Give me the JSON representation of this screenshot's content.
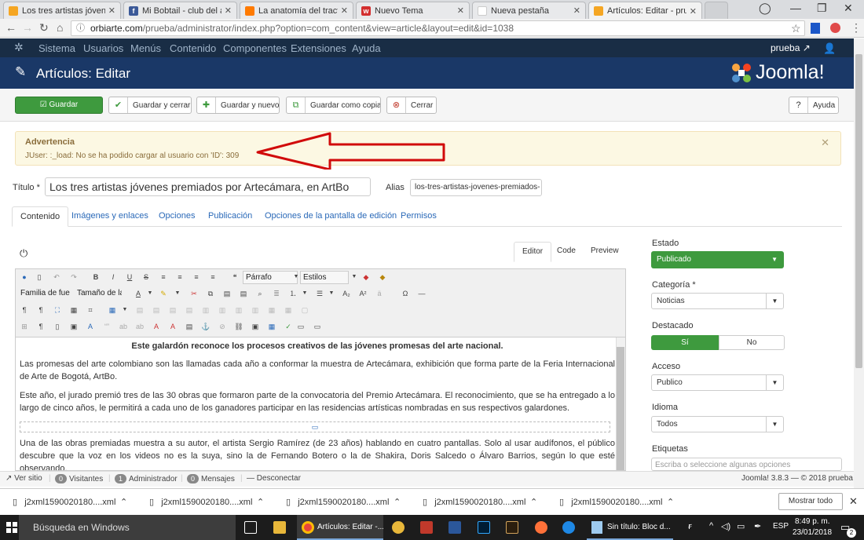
{
  "browser": {
    "tabs": [
      {
        "title": "Los tres artistas jóvenes p",
        "fav": "#f5a623",
        "active": false
      },
      {
        "title": "Mi Bobtail - club del ant",
        "fav": "#3b5998",
        "active": false
      },
      {
        "title": "La anatomía del tracto d",
        "fav": "#ff7a00",
        "active": false
      },
      {
        "title": "Nuevo Tema",
        "fav": "#d32f2f",
        "active": false
      },
      {
        "title": "Nueva pestaña",
        "fav": "#ffffff",
        "active": false
      },
      {
        "title": "Artículos: Editar - prueba",
        "fav": "#f5a623",
        "active": true
      }
    ],
    "url_domain": "orbiarte.com",
    "url_path": "/prueba/administrator/index.php?option=com_content&view=article&layout=edit&id=1038"
  },
  "adminbar": {
    "items": [
      "Sistema",
      "Usuarios",
      "Menús",
      "Contenido",
      "Componentes",
      "Extensiones",
      "Ayuda"
    ],
    "user": "prueba"
  },
  "titlebar": {
    "title": "Artículos: Editar",
    "brand": "Joomla!"
  },
  "toolbar": {
    "save": "Guardar",
    "save_close": "Guardar y cerrar",
    "save_new": "Guardar y nuevo",
    "save_copy": "Guardar como copia",
    "close": "Cerrar",
    "help": "Ayuda"
  },
  "warning": {
    "heading": "Advertencia",
    "message": "JUser: :_load: No se ha podido cargar al usuario con 'ID': 309"
  },
  "form": {
    "title_label": "Título *",
    "title_value": "Los tres artistas jóvenes premiados por Artecámara, en ArtBo",
    "alias_label": "Alias",
    "alias_value": "los-tres-artistas-jovenes-premiados-"
  },
  "content_tabs": [
    "Contenido",
    "Imágenes y enlaces",
    "Opciones",
    "Publicación",
    "Opciones de la pantalla de edición",
    "Permisos"
  ],
  "editor": {
    "mode_tabs": [
      "Editor",
      "Code",
      "Preview"
    ],
    "format_select": "Párrafo",
    "styles_select": "Estilos",
    "font_family": "Familia de fue",
    "font_size": "Tamaño de la",
    "paragraphs": [
      "Este galardón reconoce los procesos creativos de las jóvenes promesas del arte nacional.",
      "Las promesas del arte colombiano son las llamadas cada año a conformar la muestra de Artecámara, exhibición que forma parte de la Feria Internacional de Arte de Bogotá, ArtBo.",
      "Este año, el jurado premió tres de las 30 obras que formaron parte de la convocatoria del Premio Artecámara. El reconocimiento, que se ha entregado a lo largo de cinco años, le permitirá a cada uno de los ganadores participar en las residencias artísticas nombradas en sus respectivos galardones.",
      "Una de las obras premiadas muestra a su autor, el artista Sergio Ramírez (de 23 años) hablando en cuatro pantallas. Solo al usar audífonos, el público descubre que la voz en los videos no es la suya, sino la de Fernando Botero o la de Shakira, Doris Salcedo o Álvaro Barrios, según lo que esté observando."
    ]
  },
  "sidebar": {
    "estado_label": "Estado",
    "estado_value": "Publicado",
    "categoria_label": "Categoría *",
    "categoria_value": "Noticias",
    "destacado_label": "Destacado",
    "destacado_yes": "Sí",
    "destacado_no": "No",
    "acceso_label": "Acceso",
    "acceso_value": "Publico",
    "idioma_label": "Idioma",
    "idioma_value": "Todos",
    "etiquetas_label": "Etiquetas",
    "etiquetas_placeholder": "Escriba o seleccione algunas opciones"
  },
  "status": {
    "ver_sitio": "Ver sitio",
    "visitantes_count": "0",
    "visitantes": "Visitantes",
    "admin_count": "1",
    "admin": "Administrador",
    "mensajes_count": "0",
    "mensajes": "Mensajes",
    "desconectar": "Desconectar",
    "version": "Joomla! 3.8.3 — © 2018 prueba"
  },
  "downloads": {
    "files": [
      "j2xml1590020180....xml",
      "j2xml1590020180....xml",
      "j2xml1590020180....xml",
      "j2xml1590020180....xml",
      "j2xml1590020180....xml"
    ],
    "show_all": "Mostrar todo"
  },
  "taskbar": {
    "search": "Búsqueda en Windows",
    "chrome_window": "Artículos: Editar -...",
    "notepad_window": "Sin título: Bloc d...",
    "lang": "ESP",
    "time": "8:49 p. m.",
    "date": "23/01/2018",
    "notif_count": "2"
  },
  "colors": {
    "admin_bg": "#192d45",
    "title_bg": "#1a3867",
    "success": "#3e9a3e",
    "warning_bg": "#fcf8e3",
    "arrow": "#d10a0a"
  }
}
